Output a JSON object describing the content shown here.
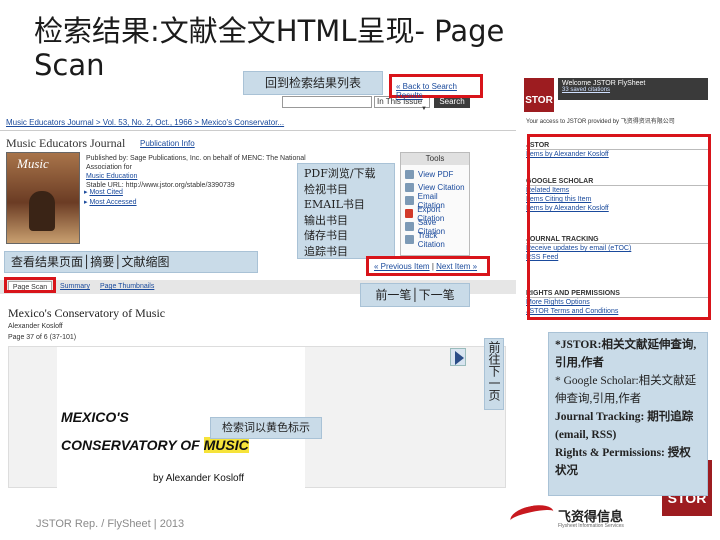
{
  "slide": {
    "title": "检索结果:文献全文HTML呈现- Page Scan",
    "footer": "JSTOR Rep. / FlySheet | 2013"
  },
  "callouts": {
    "back_to_list": "回到检索结果列表",
    "pdf_tools": [
      "PDF浏览/下载",
      "检视书目",
      "EMAIL书目",
      "输出书目",
      "储存书目",
      "追踪书目"
    ],
    "view_modes": "查看结果页面│摘要│文献缩图",
    "prev_next": "前一笔│下一笔",
    "keyword_highlight": "检索词以黄色标示",
    "page_turn": "前往下一页",
    "jstor_notes": [
      "*JSTOR:相关文献延伸查询,引用,作者",
      "* Google Scholar:相关文献延伸查询,引用,作者",
      "Journal Tracking: 期刊追踪(email, RSS)",
      "Rights & Permissions: 授权状况"
    ]
  },
  "search": {
    "back_link": "« Back to Search Results",
    "scope_value": "In This Issue",
    "search_button": "Search"
  },
  "breadcrumb": "Music Educators Journal > Vol. 53, No. 2, Oct., 1966 > Mexico's Conservator...",
  "journal": {
    "name": "Music Educators Journal",
    "pub_info_link": "Publication Info",
    "meta_lines": [
      "Published by: Sage Publications, Inc. on behalf of MENC: The National Association for",
      "Music Education",
      "Stable URL: http://www.jstor.org/stable/3390739"
    ],
    "cover_title": "Music",
    "links": [
      "Most Cited",
      "Most Accessed"
    ]
  },
  "tools": {
    "heading": "Tools",
    "items": [
      "View PDF",
      "View Citation",
      "Email Citation",
      "Export Citation",
      "Save Citation",
      "Track Citation"
    ]
  },
  "pager": {
    "prev": "« Previous Item",
    "next": "Next Item »"
  },
  "tabs": [
    "Page Scan",
    "Summary",
    "Page Thumbnails"
  ],
  "article": {
    "title": "Mexico's Conservatory of Music",
    "author": "Alexander Kosloff",
    "pages": "Page 37 of 6 (37-101)",
    "scan_line1": "MEXICO'S",
    "scan_line2a": "CONSERVATORY",
    "scan_of": "OF",
    "scan_highlight": "MUSIC",
    "scan_byline": "by Alexander Kosloff"
  },
  "sidebar": {
    "welcome_title": "Welcome JSTOR FlySheet",
    "welcome_sub": "33 saved citations",
    "access_note": "Your access to JSTOR provided by 飞资得资讯有限公司",
    "sections": [
      {
        "title": "JSTOR",
        "links": [
          "Items by Alexander Kosloff"
        ]
      },
      {
        "title": "GOOGLE SCHOLAR",
        "links": [
          "Related Items",
          "Items Citing this Item",
          "Items by Alexander Kosloff"
        ]
      },
      {
        "title": "JOURNAL TRACKING",
        "links": [
          "Receive updates by email (eTOC)",
          "RSS Feed"
        ]
      },
      {
        "title": "RIGHTS AND PERMISSIONS",
        "links": [
          "More Rights Options",
          "JSTOR Terms and Conditions"
        ]
      }
    ],
    "logo": "STOR"
  },
  "brand": {
    "company_cn": "飞资得信息",
    "company_tag": "Flysheet Information Services"
  }
}
